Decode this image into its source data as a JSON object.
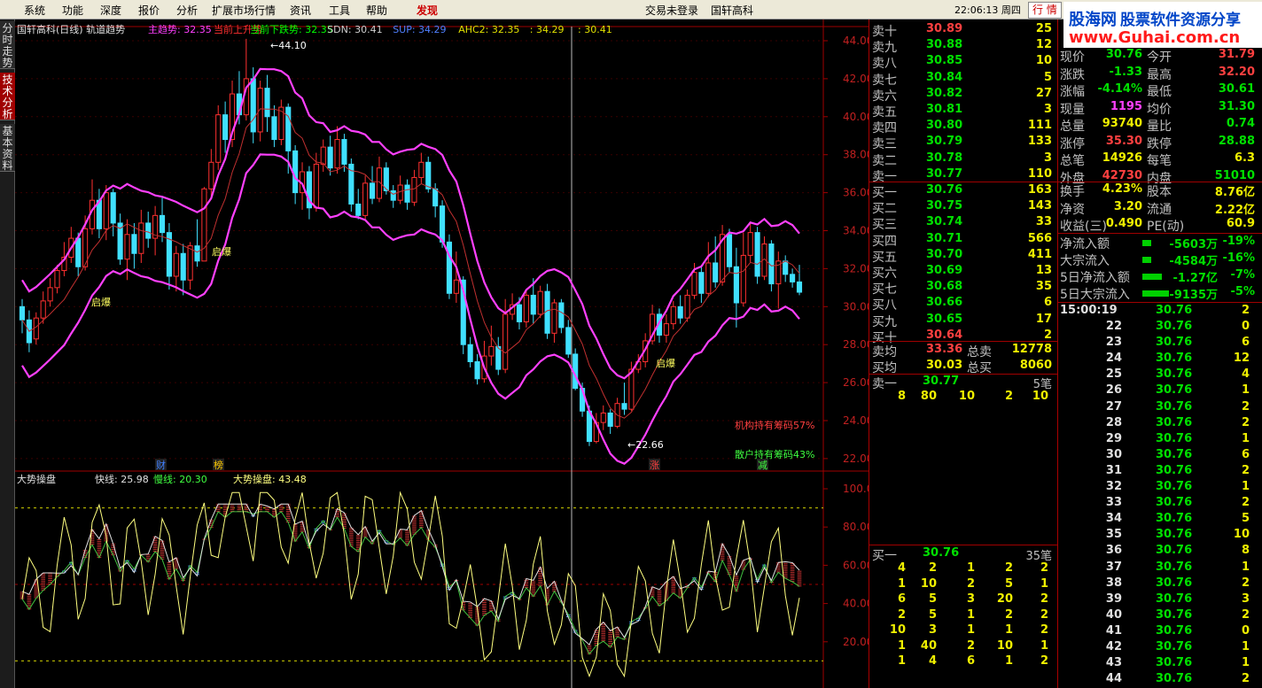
{
  "menu": {
    "items": [
      "系统",
      "功能",
      "深度",
      "报价",
      "分析",
      "扩展市场行情",
      "资讯",
      "工具",
      "帮助"
    ],
    "discover": "发现",
    "login": "交易未登录",
    "stock_name": "国轩高科",
    "time": "22:06:13",
    "weekday": "周四",
    "tab": "行 情"
  },
  "logo": {
    "line1": "股海网",
    "line1b": "股票软件资源分享",
    "line2": "www.Guhai.com.cn"
  },
  "left_tabs": [
    "分时走势",
    "技术分析",
    "基本资料"
  ],
  "chart": {
    "header": {
      "title": "国轩高科(日线) 轨道趋势",
      "items": [
        {
          "t": "主趋势: 32.35",
          "c": "#ff40ff"
        },
        {
          "t": "当前上升势",
          "c": "#ff3030"
        },
        {
          "t": "当前下跌势: 32.35",
          "c": "#00ff00"
        },
        {
          "t": "SDN: 30.41",
          "c": "#d0d0d0"
        },
        {
          "t": "SUP: 34.29",
          "c": "#5080ff"
        },
        {
          "t": "AHC2: 32.35",
          "c": "#e0e000"
        },
        {
          "t": ": 34.29",
          "c": "#e0e000"
        },
        {
          "t": ": 30.41",
          "c": "#e0e000"
        }
      ]
    },
    "y_ticks": [
      "44.00",
      "42.00",
      "40.00",
      "38.00",
      "36.00",
      "34.00",
      "32.00",
      "30.00",
      "28.00",
      "26.00",
      "24.00",
      "22.00"
    ],
    "high_label": "44.10",
    "low_label": "22.66",
    "qibao": "启爆",
    "inst_label": "机构持有筹码57%",
    "retail_label": "散户持有筹码43%",
    "markers": [
      "财",
      "榜",
      "涨",
      "减"
    ],
    "sub_header": {
      "name": "大势操盘",
      "fast": "快线: 25.98",
      "slow": "慢线: 20.30",
      "main": "大势操盘: 43.48"
    },
    "sub_ticks": [
      "100.0",
      "80.00",
      "60.00",
      "40.00",
      "20.00"
    ]
  },
  "orderbook": {
    "sells": [
      [
        "卖十",
        "30.89",
        "25"
      ],
      [
        "卖九",
        "30.88",
        "12"
      ],
      [
        "卖八",
        "30.85",
        "10"
      ],
      [
        "卖七",
        "30.84",
        "5"
      ],
      [
        "卖六",
        "30.82",
        "27"
      ],
      [
        "卖五",
        "30.81",
        "3"
      ],
      [
        "卖四",
        "30.80",
        "111"
      ],
      [
        "卖三",
        "30.79",
        "133"
      ],
      [
        "卖二",
        "30.78",
        "3"
      ],
      [
        "卖一",
        "30.77",
        "110"
      ]
    ],
    "buys": [
      [
        "买一",
        "30.76",
        "163"
      ],
      [
        "买二",
        "30.75",
        "143"
      ],
      [
        "买三",
        "30.74",
        "33"
      ],
      [
        "买四",
        "30.71",
        "566"
      ],
      [
        "买五",
        "30.70",
        "411"
      ],
      [
        "买六",
        "30.69",
        "13"
      ],
      [
        "买七",
        "30.68",
        "35"
      ],
      [
        "买八",
        "30.66",
        "6"
      ],
      [
        "买九",
        "30.65",
        "17"
      ],
      [
        "买十",
        "30.64",
        "2"
      ]
    ],
    "avg_sell": {
      "label": "卖均",
      "value": "33.36",
      "tlabel": "总卖",
      "total": "12778"
    },
    "avg_buy": {
      "label": "买均",
      "value": "30.03",
      "tlabel": "总买",
      "total": "8060"
    },
    "queue_sell": {
      "label": "卖一",
      "price": "30.77",
      "count": "5笔",
      "items": [
        "8",
        "80",
        "10",
        "2",
        "10"
      ]
    },
    "queue_buy": {
      "label": "买一",
      "price": "30.76",
      "count": "35笔",
      "rows": [
        [
          "4",
          "2",
          "1",
          "2",
          "2"
        ],
        [
          "1",
          "10",
          "2",
          "5",
          "1"
        ],
        [
          "6",
          "5",
          "3",
          "20",
          "2"
        ],
        [
          "2",
          "5",
          "1",
          "2",
          "2"
        ],
        [
          "10",
          "3",
          "1",
          "1",
          "2"
        ],
        [
          "1",
          "40",
          "2",
          "10",
          "1"
        ],
        [
          "1",
          "4",
          "6",
          "1",
          "2"
        ]
      ]
    }
  },
  "quote": {
    "rows": [
      {
        "l": "现价",
        "v": "30.76",
        "vc": "g",
        "l2": "今开",
        "v2": "31.79",
        "v2c": "r"
      },
      {
        "l": "涨跌",
        "v": "-1.33",
        "vc": "g",
        "l2": "最高",
        "v2": "32.20",
        "v2c": "r"
      },
      {
        "l": "涨幅",
        "v": "-4.14%",
        "vc": "g",
        "l2": "最低",
        "v2": "30.61",
        "v2c": "g"
      },
      {
        "l": "现量",
        "v": "1195",
        "vc": "mag",
        "l2": "均价",
        "v2": "31.30",
        "v2c": "g"
      },
      {
        "l": "总量",
        "v": "93740",
        "vc": "y",
        "l2": "量比",
        "v2": "0.74",
        "v2c": "g"
      },
      {
        "l": "涨停",
        "v": "35.30",
        "vc": "r",
        "l2": "跌停",
        "v2": "28.88",
        "v2c": "g"
      },
      {
        "l": "总笔",
        "v": "14926",
        "vc": "y",
        "l2": "每笔",
        "v2": "6.3",
        "v2c": "y"
      },
      {
        "l": "外盘",
        "v": "42730",
        "vc": "r",
        "l2": "内盘",
        "v2": "51010",
        "v2c": "g"
      }
    ],
    "rows2": [
      {
        "l": "换手",
        "v": "4.23%",
        "vc": "y",
        "l2": "股本",
        "v2": "8.76亿",
        "v2c": "y"
      },
      {
        "l": "净资",
        "v": "3.20",
        "vc": "y",
        "l2": "流通",
        "v2": "2.22亿",
        "v2c": "y"
      },
      {
        "l": "收益(三)",
        "v": "0.490",
        "vc": "y",
        "l2": "PE(动)",
        "v2": "60.9",
        "v2c": "y"
      }
    ],
    "flows": [
      [
        "净流入额",
        "-5603万",
        "-19%"
      ],
      [
        "大宗流入",
        "-4584万",
        "-16%"
      ],
      [
        "5日净流入额",
        "-1.27亿",
        "-7%"
      ],
      [
        "5日大宗流入",
        "-9135万",
        "-5%"
      ]
    ],
    "ticks_first": "15:00:19",
    "ticks": [
      [
        "22",
        "30.76",
        "0"
      ],
      [
        "23",
        "30.76",
        "6"
      ],
      [
        "24",
        "30.76",
        "12"
      ],
      [
        "25",
        "30.76",
        "4"
      ],
      [
        "26",
        "30.76",
        "1"
      ],
      [
        "27",
        "30.76",
        "2"
      ],
      [
        "28",
        "30.76",
        "2"
      ],
      [
        "29",
        "30.76",
        "1"
      ],
      [
        "30",
        "30.76",
        "6"
      ],
      [
        "31",
        "30.76",
        "2"
      ],
      [
        "32",
        "30.76",
        "1"
      ],
      [
        "33",
        "30.76",
        "2"
      ],
      [
        "34",
        "30.76",
        "5"
      ],
      [
        "35",
        "30.76",
        "10"
      ],
      [
        "36",
        "30.76",
        "8"
      ],
      [
        "37",
        "30.76",
        "1"
      ],
      [
        "38",
        "30.76",
        "2"
      ],
      [
        "39",
        "30.76",
        "3"
      ],
      [
        "40",
        "30.76",
        "2"
      ],
      [
        "41",
        "30.76",
        "0"
      ],
      [
        "42",
        "30.76",
        "1"
      ],
      [
        "43",
        "30.76",
        "1"
      ],
      [
        "44",
        "30.76",
        "2"
      ]
    ],
    "ticks_first_v": [
      "30.76",
      "2"
    ]
  }
}
